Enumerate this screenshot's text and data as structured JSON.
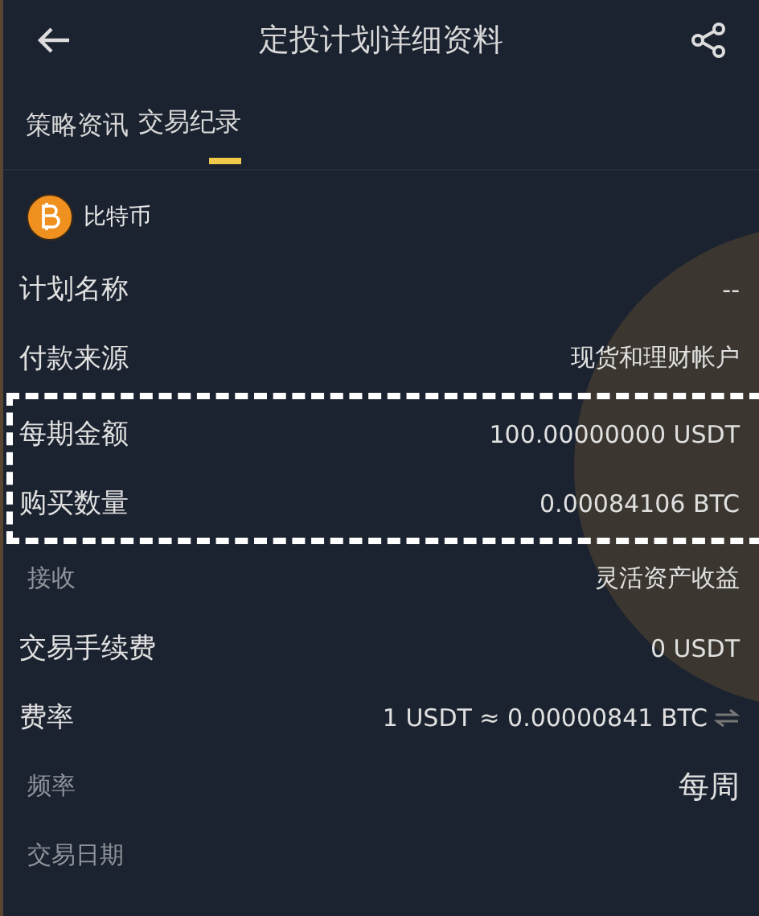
{
  "header": {
    "title": "定投计划详细资料"
  },
  "tabs": [
    {
      "label": "策略资讯",
      "selected": false
    },
    {
      "label": "交易纪录",
      "selected": true
    }
  ],
  "coin": {
    "name": "比特币"
  },
  "rows": [
    {
      "label": "计划名称",
      "value": "--",
      "muted": false,
      "highlight": false
    },
    {
      "label": "付款来源",
      "value": "现货和理财帐户",
      "muted": false,
      "highlight": false
    },
    {
      "label": "每期金额",
      "value": "100.00000000 USDT",
      "muted": false,
      "highlight": true
    },
    {
      "label": "购买数量",
      "value": "0.00084106 BTC",
      "muted": false,
      "highlight": true
    },
    {
      "label": "接收",
      "value": "灵活资产收益",
      "muted": true,
      "highlight": false
    },
    {
      "label": "交易手续费",
      "value": "0 USDT",
      "muted": false,
      "highlight": false
    },
    {
      "label": "费率",
      "value": "1 USDT ≈ 0.00000841 BTC",
      "muted": false,
      "highlight": false,
      "swap": true
    },
    {
      "label": "频率",
      "value": "每周",
      "muted": true,
      "highlight": false,
      "big": true
    },
    {
      "label": "交易日期",
      "muted": true,
      "highlight": false
    }
  ]
}
